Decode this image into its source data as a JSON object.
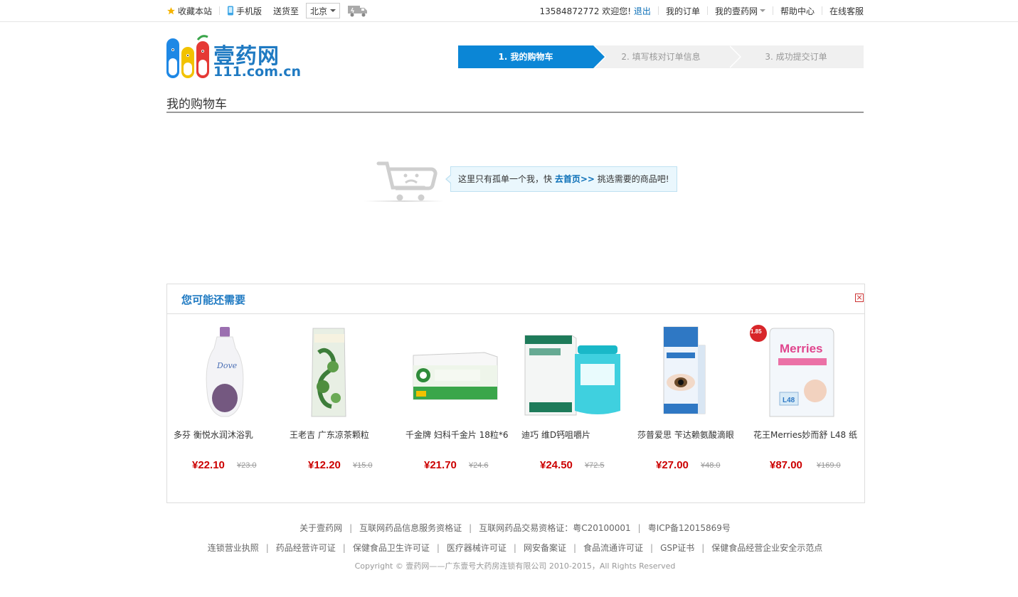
{
  "topbar": {
    "bookmark": "收藏本站",
    "mobile": "手机版",
    "ship_to_label": "送货至",
    "city": "北京",
    "user_phone": "13584872772",
    "welcome": "欢迎您!",
    "logout": "退出",
    "my_orders": "我的订单",
    "my_account": "我的壹药网",
    "help": "帮助中心",
    "service": "在线客服"
  },
  "logo": {
    "cn": "壹药网",
    "en": "111.com.cn"
  },
  "steps": [
    {
      "label": "1. 我的购物车"
    },
    {
      "label": "2. 填写核对订单信息"
    },
    {
      "label": "3. 成功提交订单"
    }
  ],
  "page": {
    "title": "我的购物车"
  },
  "empty_cart": {
    "text_before": "这里只有孤单一个我，快",
    "link": "去首页>>",
    "text_after": "挑选需要的商品吧!"
  },
  "recommend": {
    "title": "您可能还需要",
    "products": [
      {
        "name": "多芬 衡悦水润沐浴乳",
        "price": "¥22.10",
        "original": "¥23.0"
      },
      {
        "name": "王老吉 广东凉茶颗粒",
        "price": "¥12.20",
        "original": "¥15.0"
      },
      {
        "name": "千金牌 妇科千金片 18粒*6",
        "price": "¥21.70",
        "original": "¥24.6"
      },
      {
        "name": "迪巧 维D钙咀嚼片",
        "price": "¥24.50",
        "original": "¥72.5"
      },
      {
        "name": "莎普爱思 苄达赖氨酸滴眼",
        "price": "¥27.00",
        "original": "¥48.0"
      },
      {
        "name": "花王Merries妙而舒 L48 纸",
        "price": "¥87.00",
        "original": "¥169.0",
        "badge": "1.85"
      }
    ]
  },
  "footer": {
    "row1": [
      "关于壹药网",
      "互联网药品信息服务资格证",
      "互联网药品交易资格证：粤C20100001",
      "粤ICP备12015869号"
    ],
    "row2": [
      "连锁营业执照",
      "药品经营许可证",
      "保健食品卫生许可证",
      "医疗器械许可证",
      "网安备案证",
      "食品流通许可证",
      "GSP证书",
      "保健食品经营企业安全示范点"
    ],
    "copyright": "Copyright © 壹药网——广东壹号大药房连锁有限公司 2010-2015，All Rights Reserved"
  },
  "colors": {
    "brand_blue": "#1f7ac2",
    "step_active": "#0b86d6",
    "price_red": "#cc0000"
  }
}
